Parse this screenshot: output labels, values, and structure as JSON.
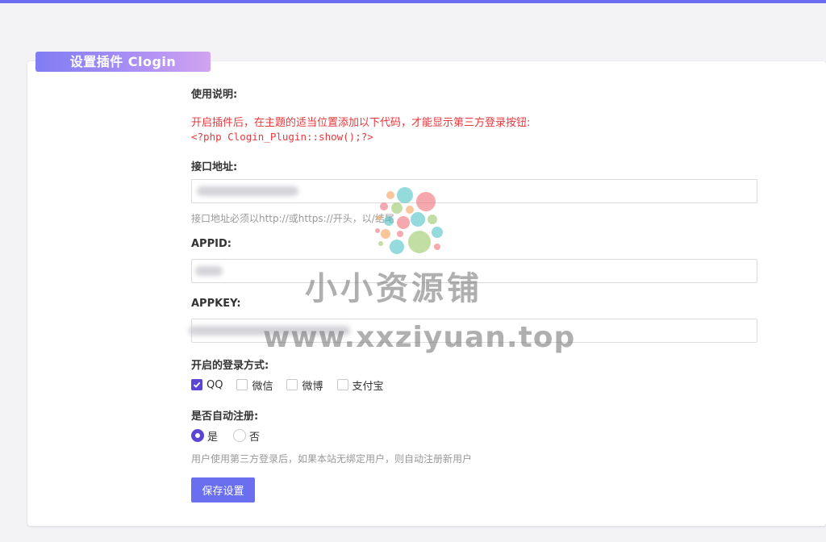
{
  "panel": {
    "title": "设置插件 Clogin"
  },
  "usage": {
    "label": "使用说明:",
    "description": "开启插件后，在主题的适当位置添加以下代码，才能显示第三方登录按钮:",
    "code": "<?php Clogin_Plugin::show();?>"
  },
  "api_url": {
    "label": "接口地址:",
    "value": "",
    "hint": "接口地址必须以http://或https://开头，以/结尾"
  },
  "appid": {
    "label": "APPID:",
    "value": ""
  },
  "appkey": {
    "label": "APPKEY:",
    "value": ""
  },
  "login_methods": {
    "label": "开启的登录方式:",
    "options": [
      {
        "label": "QQ",
        "checked": true
      },
      {
        "label": "微信",
        "checked": false
      },
      {
        "label": "微博",
        "checked": false
      },
      {
        "label": "支付宝",
        "checked": false
      }
    ]
  },
  "auto_register": {
    "label": "是否自动注册:",
    "options": [
      {
        "label": "是",
        "checked": true
      },
      {
        "label": "否",
        "checked": false
      }
    ],
    "hint": "用户使用第三方登录后，如果本站无绑定用户，则自动注册新用户"
  },
  "save_button": {
    "label": "保存设置"
  },
  "watermark": {
    "line1": "小小资源铺",
    "line2": "www.xxziyuan.top"
  },
  "colors": {
    "accent": "#6a6ff0",
    "check": "#5b45d6",
    "warning": "#e8383d"
  }
}
